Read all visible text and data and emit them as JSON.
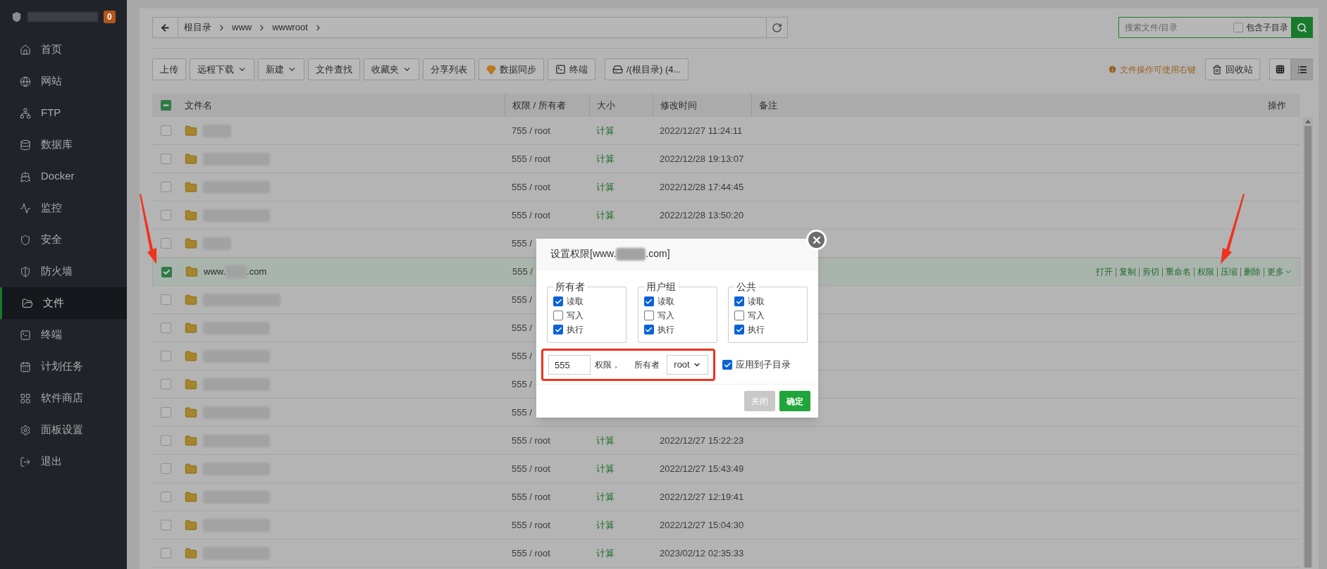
{
  "sidebar": {
    "badge": "0",
    "items": [
      {
        "label": "首页",
        "selected": false
      },
      {
        "label": "网站",
        "selected": false
      },
      {
        "label": "FTP",
        "selected": false
      },
      {
        "label": "数据库",
        "selected": false
      },
      {
        "label": "Docker",
        "selected": false
      },
      {
        "label": "监控",
        "selected": false
      },
      {
        "label": "安全",
        "selected": false
      },
      {
        "label": "防火墙",
        "selected": false
      },
      {
        "label": "文件",
        "selected": true
      },
      {
        "label": "终端",
        "selected": false
      },
      {
        "label": "计划任务",
        "selected": false
      },
      {
        "label": "软件商店",
        "selected": false
      },
      {
        "label": "面板设置",
        "selected": false
      },
      {
        "label": "退出",
        "selected": false
      }
    ]
  },
  "breadcrumb": [
    "根目录",
    "www",
    "wwwroot"
  ],
  "search": {
    "placeholder": "搜索文件/目录",
    "subdir": {
      "label": "包含子目录",
      "checked": false
    }
  },
  "toolbar": [
    {
      "label": "上传",
      "kind": "plain"
    },
    {
      "label": "远程下载",
      "kind": "dropdown"
    },
    {
      "label": "新建",
      "kind": "dropdown"
    },
    {
      "label": "文件查找",
      "kind": "plain"
    },
    {
      "label": "收藏夹",
      "kind": "dropdown"
    },
    {
      "label": "分享列表",
      "kind": "plain"
    },
    {
      "label": "数据同步",
      "kind": "sync"
    },
    {
      "label": "终端",
      "kind": "terminal"
    },
    {
      "label": "/(根目录) (4...",
      "kind": "disk"
    }
  ],
  "hint": "文件操作可使用右键",
  "recycle": "回收站",
  "views": [
    {
      "kind": "grid",
      "selected": false
    },
    {
      "kind": "list",
      "selected": true
    }
  ],
  "table": {
    "header_indeterminate": true,
    "columns": [
      "文件名",
      "权限 / 所有者",
      "大小",
      "修改时间",
      "备注",
      "操作"
    ],
    "rows": [
      {
        "redacted": true,
        "perm": "755 / root",
        "size": "计算",
        "time": "2022/12/27 11:24:11",
        "selected": false
      },
      {
        "redacted": true,
        "perm": "555 / root",
        "size": "计算",
        "time": "2022/12/28 19:13:07",
        "selected": false
      },
      {
        "redacted": true,
        "perm": "555 / root",
        "size": "计算",
        "time": "2022/12/28 17:44:45",
        "selected": false
      },
      {
        "redacted": true,
        "perm": "555 / root",
        "size": "计算",
        "time": "2022/12/28 13:50:20",
        "selected": false
      },
      {
        "redacted": true,
        "perm": "555 /",
        "selected": false
      },
      {
        "redacted": false,
        "name_parts": [
          "www.",
          ".com"
        ],
        "perm": "555 /",
        "selected": true,
        "actions": [
          "打开",
          "复制",
          "剪切",
          "重命名",
          "权限",
          "压缩",
          "删除",
          "更多"
        ]
      },
      {
        "redacted": true,
        "perm": "555 /",
        "selected": false
      },
      {
        "redacted": true,
        "perm": "555 /",
        "selected": false
      },
      {
        "redacted": true,
        "perm": "555 /",
        "selected": false
      },
      {
        "redacted": true,
        "perm": "555 /",
        "selected": false
      },
      {
        "redacted": true,
        "perm": "555 /",
        "selected": false
      },
      {
        "redacted": true,
        "perm": "555 / root",
        "size": "计算",
        "time": "2022/12/27 15:22:23",
        "selected": false
      },
      {
        "redacted": true,
        "perm": "555 / root",
        "size": "计算",
        "time": "2022/12/27 15:43:49",
        "selected": false
      },
      {
        "redacted": true,
        "perm": "555 / root",
        "size": "计算",
        "time": "2022/12/27 12:19:41",
        "selected": false
      },
      {
        "redacted": true,
        "perm": "555 / root",
        "size": "计算",
        "time": "2022/12/27 15:04:30",
        "selected": false
      },
      {
        "redacted": true,
        "perm": "555 / root",
        "size": "计算",
        "time": "2023/02/12 02:35:33",
        "selected": false
      }
    ]
  },
  "modal": {
    "title_parts": [
      "设置权限[www.",
      ".com]"
    ],
    "groups": [
      {
        "title": "所有者",
        "perms": [
          {
            "label": "读取",
            "checked": true
          },
          {
            "label": "写入",
            "checked": false
          },
          {
            "label": "执行",
            "checked": true
          }
        ]
      },
      {
        "title": "用户组",
        "perms": [
          {
            "label": "读取",
            "checked": true
          },
          {
            "label": "写入",
            "checked": false
          },
          {
            "label": "执行",
            "checked": true
          }
        ]
      },
      {
        "title": "公共",
        "perms": [
          {
            "label": "读取",
            "checked": true
          },
          {
            "label": "写入",
            "checked": false
          },
          {
            "label": "执行",
            "checked": true
          }
        ]
      }
    ],
    "mode_value": "555",
    "mode_label": "权限，",
    "owner_label": "所有者",
    "owner_value": "root",
    "apply_subdir": {
      "label": "应用到子目录",
      "checked": true
    },
    "buttons": [
      {
        "label": "关闭",
        "kind": "cancel"
      },
      {
        "label": "确定",
        "kind": "confirm"
      }
    ]
  }
}
